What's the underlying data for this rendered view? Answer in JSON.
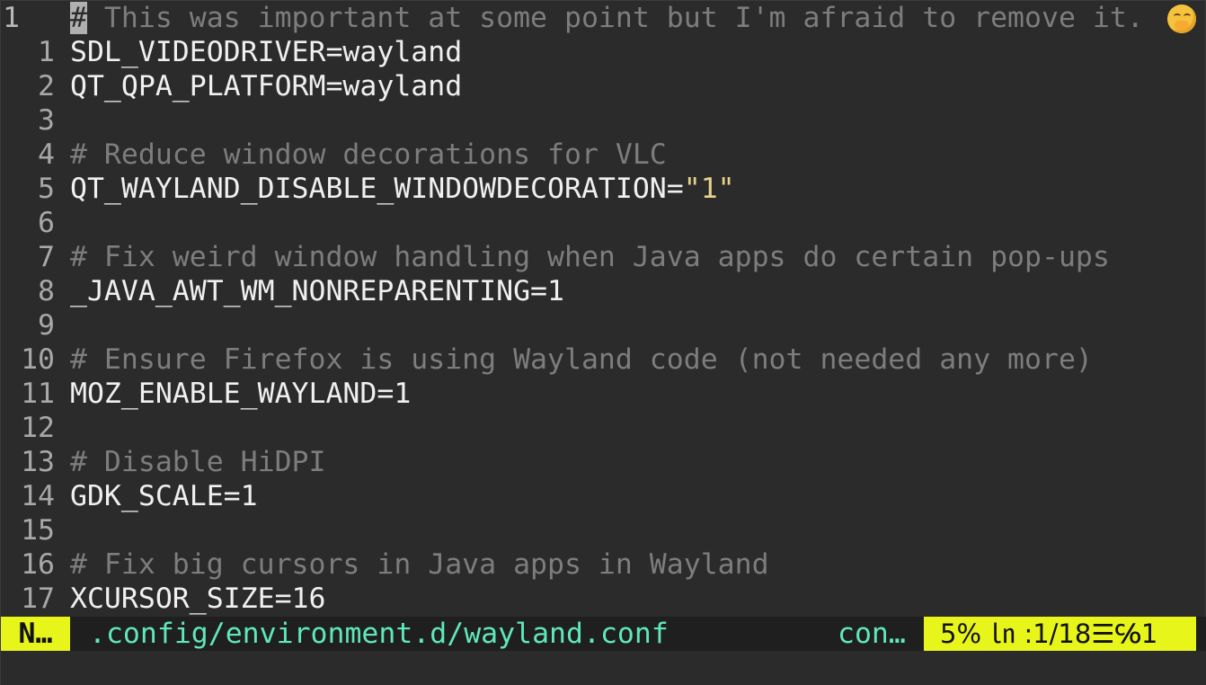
{
  "editor": {
    "first_line": {
      "number": "1",
      "cursor_char": "#",
      "text": " This was important at some point but I'm afraid to remove it.",
      "emoji_icon": "face-with-hand-over-mouth-icon"
    },
    "lines": [
      {
        "number": "1",
        "text": "SDL_VIDEODRIVER=wayland",
        "kind": "code"
      },
      {
        "number": "2",
        "text": "QT_QPA_PLATFORM=wayland",
        "kind": "code"
      },
      {
        "number": "3",
        "text": "",
        "kind": "blank"
      },
      {
        "number": "4",
        "text": "# Reduce window decorations for VLC",
        "kind": "comment"
      },
      {
        "number": "5",
        "text": "QT_WAYLAND_DISABLE_WINDOWDECORATION=",
        "string": "\"1\"",
        "kind": "code-string"
      },
      {
        "number": "6",
        "text": "",
        "kind": "blank"
      },
      {
        "number": "7",
        "text": "# Fix weird window handling when Java apps do certain pop-ups",
        "kind": "comment"
      },
      {
        "number": "8",
        "text": "_JAVA_AWT_WM_NONREPARENTING=1",
        "kind": "code"
      },
      {
        "number": "9",
        "text": "",
        "kind": "blank"
      },
      {
        "number": "10",
        "text": "# Ensure Firefox is using Wayland code (not needed any more)",
        "kind": "comment"
      },
      {
        "number": "11",
        "text": "MOZ_ENABLE_WAYLAND=1",
        "kind": "code"
      },
      {
        "number": "12",
        "text": "",
        "kind": "blank"
      },
      {
        "number": "13",
        "text": "# Disable HiDPI",
        "kind": "comment"
      },
      {
        "number": "14",
        "text": "GDK_SCALE=1",
        "kind": "code"
      },
      {
        "number": "15",
        "text": "",
        "kind": "blank"
      },
      {
        "number": "16",
        "text": "# Fix big cursors in Java apps in Wayland",
        "kind": "comment"
      },
      {
        "number": "17",
        "text": "XCURSOR_SIZE=16",
        "kind": "code"
      }
    ]
  },
  "statusbar": {
    "mode": "N…",
    "filepath": ".config/environment.d/wayland.conf",
    "filetype": "con…",
    "position": "5% ㏑ :1/18☰℅1"
  },
  "colors": {
    "background": "#2b2b2b",
    "text": "#f0f0f0",
    "comment": "#7d7d7d",
    "string": "#e6d28a",
    "status_accent": "#e8f51a",
    "status_path": "#5fe8b8"
  }
}
